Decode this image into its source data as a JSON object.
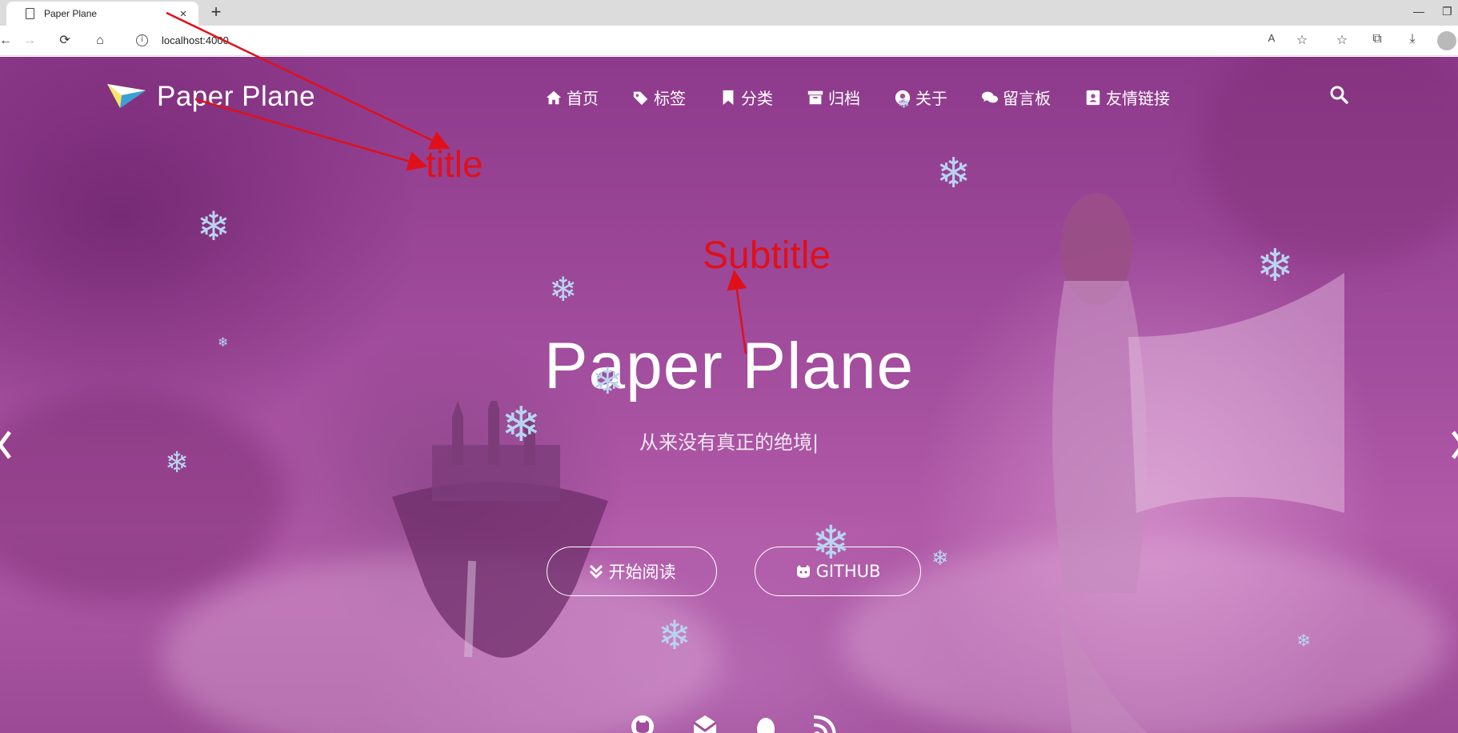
{
  "browser": {
    "tab_title": "Paper Plane",
    "tab_close": "×",
    "new_tab": "+",
    "url": "localhost:4000",
    "controls": [
      "minimize-icon",
      "restore-icon"
    ]
  },
  "site": {
    "title": "Paper Plane",
    "nav": [
      {
        "label": "首页",
        "icon": "home-icon"
      },
      {
        "label": "标签",
        "icon": "tags-icon"
      },
      {
        "label": "分类",
        "icon": "bookmark-icon"
      },
      {
        "label": "归档",
        "icon": "archive-icon"
      },
      {
        "label": "关于",
        "icon": "user-circle-icon"
      },
      {
        "label": "留言板",
        "icon": "comments-icon"
      },
      {
        "label": "友情链接",
        "icon": "address-book-icon"
      }
    ],
    "search_icon": "search-icon"
  },
  "hero": {
    "title": "Paper Plane",
    "subtitle": "从来没有真正的绝境|",
    "buttons": {
      "read": "开始阅读",
      "github": "GITHUB"
    }
  },
  "social_icons": [
    "github-icon",
    "email-icon",
    "qq-icon",
    "rss-icon"
  ],
  "annotations": {
    "title": "title",
    "subtitle": "Subtitle",
    "color": "#e0101a"
  },
  "colors": {
    "background": "#a24d9d",
    "text": "#ffffff",
    "snowflake": "#b8d4f0"
  }
}
